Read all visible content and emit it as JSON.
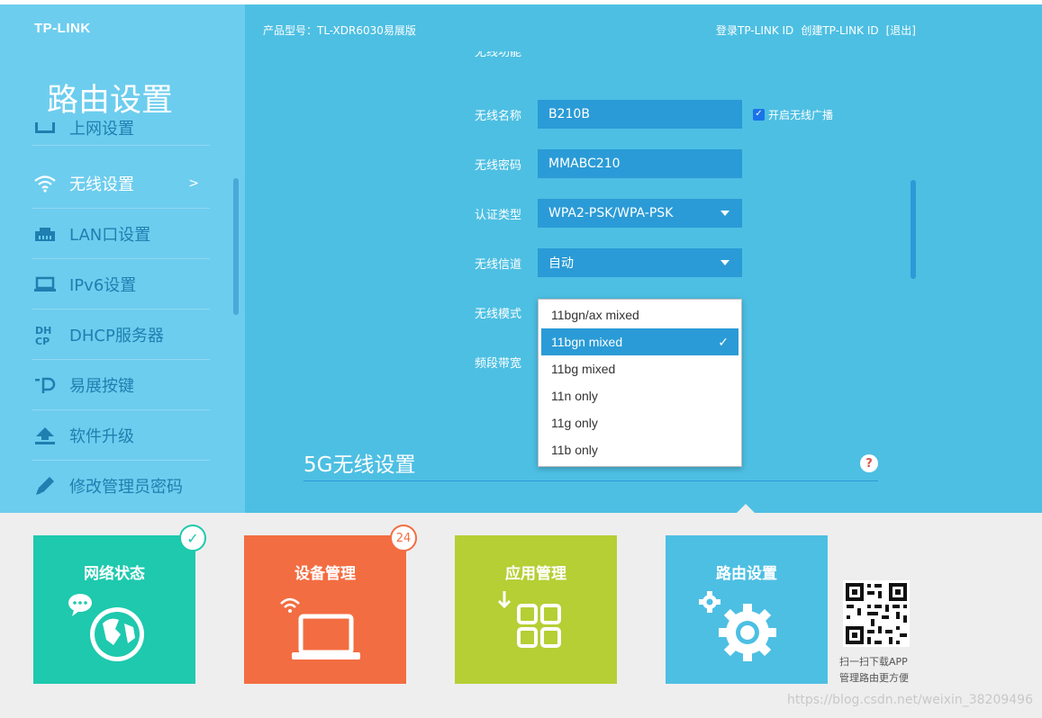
{
  "sidebar": {
    "logo": "TP-LINK",
    "title": "路由设置",
    "items": [
      {
        "label": "上网设置"
      },
      {
        "label": "无线设置",
        "arrow": ">"
      },
      {
        "label": "LAN口设置"
      },
      {
        "label": "IPv6设置"
      },
      {
        "label": "DHCP服务器"
      },
      {
        "label": "易展按键"
      },
      {
        "label": "软件升级"
      },
      {
        "label": "修改管理员密码"
      }
    ]
  },
  "header": {
    "model": "产品型号：TL-XDR6030易展版",
    "login": "登录TP-LINK ID",
    "create": "创建TP-LINK ID",
    "logout": "[退出]"
  },
  "form": {
    "partial_label": "无线功能",
    "ssid_label": "无线名称",
    "ssid_value": "B210B",
    "broadcast_label": "开启无线广播",
    "broadcast_checked": true,
    "password_label": "无线密码",
    "password_value": "MMABC210",
    "auth_label": "认证类型",
    "auth_value": "WPA2-PSK/WPA-PSK",
    "channel_label": "无线信道",
    "channel_value": "自动",
    "mode_label": "无线模式",
    "bandwidth_label": "频段带宽"
  },
  "mode_options": [
    {
      "label": "11bgn/ax mixed",
      "selected": false
    },
    {
      "label": "11bgn mixed",
      "selected": true
    },
    {
      "label": "11bg mixed",
      "selected": false
    },
    {
      "label": "11n only",
      "selected": false
    },
    {
      "label": "11g only",
      "selected": false
    },
    {
      "label": "11b only",
      "selected": false
    }
  ],
  "section_5g": {
    "title": "5G无线设置",
    "help": "?"
  },
  "tiles": [
    {
      "label": "网络状态",
      "color": "#1ec9ae"
    },
    {
      "label": "设备管理",
      "color": "#f36d42",
      "badge": "24"
    },
    {
      "label": "应用管理",
      "color": "#b5cf35"
    },
    {
      "label": "路由设置",
      "color": "#4dbfe3"
    }
  ],
  "app": {
    "line1": "扫一扫下载APP",
    "line2": "管理路由更方便"
  },
  "watermark": "https://blog.csdn.net/weixin_38209496"
}
